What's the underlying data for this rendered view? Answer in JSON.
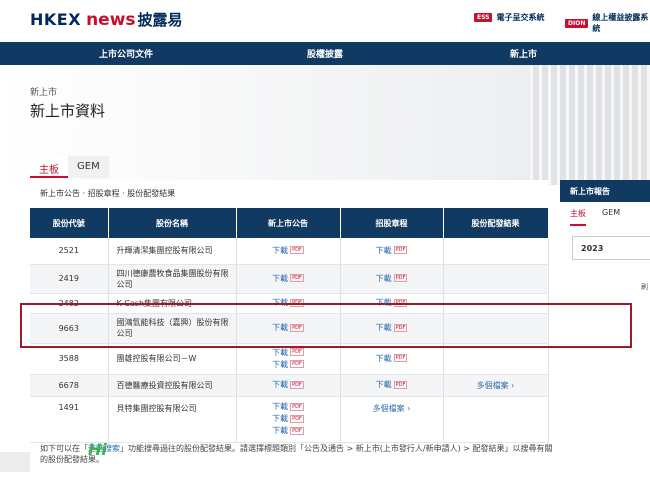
{
  "header": {
    "logo_hkex": "HKEX",
    "logo_news": "news",
    "logo_cn": "披露易",
    "sys1_tag": "ESS",
    "sys1_label": "電子呈交系統",
    "sys2_tag": "DION",
    "sys2_label": "線上權益披露系統"
  },
  "nav": {
    "items": [
      "上市公司文件",
      "股權披露",
      "新上市"
    ]
  },
  "page": {
    "breadcrumb": "新上市",
    "title": "新上市資料"
  },
  "tabs": [
    "主板",
    "GEM"
  ],
  "sublinks": "新上市公告 · 招股章程 · 股份配發結果",
  "table": {
    "headers": [
      "股份代號",
      "股份名稱",
      "新上市公告",
      "招股章程",
      "股份配發結果"
    ],
    "download_label": "下載",
    "pdf_label": "PDF",
    "more_label": "多個檔案",
    "rows": [
      {
        "code": "2521",
        "name": "升輝清潔集團控股有限公司"
      },
      {
        "code": "2419",
        "name": "四川德康農牧食品集團股份有限公司"
      },
      {
        "code": "2482",
        "name": "K Cash集團有限公司"
      },
      {
        "code": "9663",
        "name": "國鴻氫能科技（嘉興）股份有限公司"
      },
      {
        "code": "3588",
        "name": "團雄控股有限公司－W"
      },
      {
        "code": "6678",
        "name": "百德醫療投資控股有限公司"
      },
      {
        "code": "1491",
        "name": "貝特集團控股有限公司"
      }
    ]
  },
  "sidebar": {
    "header": "新上市報告",
    "tabs": [
      "主板",
      "GEM"
    ],
    "year": "2023",
    "trail": "刷"
  },
  "footer": {
    "text_a": "如下可以在「",
    "link": "進階搜索",
    "text_b": "」功能搜尋過往的股份配發結果。請選擇標題類別「公告及通告 > 新上市(上市發行人/新申請人) > 配發結果」以搜尋有關的股份配發結果。"
  },
  "watermark": "Hi"
}
